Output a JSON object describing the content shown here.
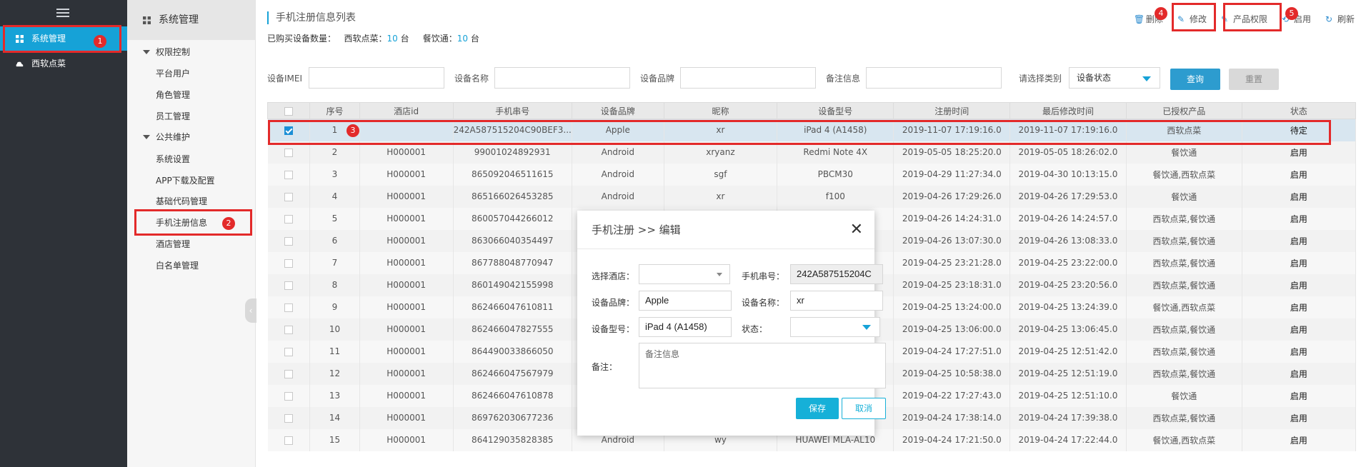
{
  "nav": {
    "items": [
      {
        "label": "系统管理",
        "icon": "grid-icon",
        "active": true
      },
      {
        "label": "西软点菜",
        "icon": "cloud-icon",
        "active": false
      }
    ]
  },
  "subnav": {
    "title": "系统管理",
    "groups": [
      {
        "label": "权限控制",
        "items": [
          "平台用户",
          "角色管理",
          "员工管理"
        ]
      },
      {
        "label": "公共维护",
        "items": [
          "系统设置",
          "APP下载及配置",
          "基础代码管理",
          "手机注册信息",
          "酒店管理",
          "白名单管理"
        ]
      }
    ]
  },
  "page": {
    "title": "手机注册信息列表",
    "summary_prefix": "已购买设备数量：",
    "summary_a_label": "西软点菜：",
    "summary_a_num": "10",
    "summary_a_unit": "台",
    "summary_b_label": "餐饮通：",
    "summary_b_num": "10",
    "summary_b_unit": "台"
  },
  "toolbar": {
    "delete": "删除",
    "edit": "修改",
    "product_perm": "产品权限",
    "enable": "启用",
    "refresh": "刷新"
  },
  "filter": {
    "imei_label": "设备IMEI",
    "name_label": "设备名称",
    "brand_label": "设备品牌",
    "remark_label": "备注信息",
    "type_label": "请选择类别",
    "type_value": "设备状态",
    "query": "查询",
    "reset": "重置"
  },
  "table": {
    "headers": [
      "序号",
      "酒店id",
      "手机串号",
      "设备品牌",
      "昵称",
      "设备型号",
      "注册时间",
      "最后修改时间",
      "已授权产品",
      "状态"
    ],
    "rows": [
      [
        "1",
        "",
        "242A587515204C90BEF3...",
        "Apple",
        "xr",
        "iPad 4 (A1458)",
        "2019-11-07 17:19:16.0",
        "2019-11-07 17:19:16.0",
        "西软点菜",
        "待定"
      ],
      [
        "2",
        "H000001",
        "99001024892931",
        "Android",
        "xryanz",
        "Redmi Note 4X",
        "2019-05-05 18:25:20.0",
        "2019-05-05 18:26:02.0",
        "餐饮通",
        "启用"
      ],
      [
        "3",
        "H000001",
        "865092046511615",
        "Android",
        "sgf",
        "PBCM30",
        "2019-04-29 11:27:34.0",
        "2019-04-30 10:13:15.0",
        "餐饮通,西软点菜",
        "启用"
      ],
      [
        "4",
        "H000001",
        "865166026453285",
        "Android",
        "xr",
        "f100",
        "2019-04-26 17:29:26.0",
        "2019-04-26 17:29:53.0",
        "餐饮通",
        "启用"
      ],
      [
        "5",
        "H000001",
        "860057044266012",
        "",
        "",
        "",
        "2019-04-26 14:24:31.0",
        "2019-04-26 14:24:57.0",
        "西软点菜,餐饮通",
        "启用"
      ],
      [
        "6",
        "H000001",
        "863066040354497",
        "",
        "",
        "",
        "2019-04-26 13:07:30.0",
        "2019-04-26 13:08:33.0",
        "西软点菜,餐饮通",
        "启用"
      ],
      [
        "7",
        "H000001",
        "867788048770947",
        "",
        "",
        "",
        "2019-04-25 23:21:28.0",
        "2019-04-25 23:22:00.0",
        "西软点菜,餐饮通",
        "启用"
      ],
      [
        "8",
        "H000001",
        "860149042155998",
        "",
        "",
        "",
        "2019-04-25 23:18:31.0",
        "2019-04-25 23:20:56.0",
        "西软点菜,餐饮通",
        "启用"
      ],
      [
        "9",
        "H000001",
        "862466047610811",
        "",
        "",
        "",
        "2019-04-25 13:24:00.0",
        "2019-04-25 13:24:39.0",
        "餐饮通,西软点菜",
        "启用"
      ],
      [
        "10",
        "H000001",
        "862466047827555",
        "",
        "",
        "",
        "2019-04-25 13:06:00.0",
        "2019-04-25 13:06:45.0",
        "西软点菜,餐饮通",
        "启用"
      ],
      [
        "11",
        "H000001",
        "864490033866050",
        "",
        "",
        "",
        "2019-04-24 17:27:51.0",
        "2019-04-25 12:51:42.0",
        "西软点菜,餐饮通",
        "启用"
      ],
      [
        "12",
        "H000001",
        "862466047567979",
        "",
        "",
        "",
        "2019-04-25 10:58:38.0",
        "2019-04-25 12:51:19.0",
        "西软点菜,餐饮通",
        "启用"
      ],
      [
        "13",
        "H000001",
        "862466047610878",
        "",
        "",
        "",
        "2019-04-22 17:27:43.0",
        "2019-04-25 12:51:10.0",
        "餐饮通",
        "启用"
      ],
      [
        "14",
        "H000001",
        "869762030677236",
        "",
        "",
        "",
        "2019-04-24 17:38:14.0",
        "2019-04-24 17:39:38.0",
        "西软点菜,餐饮通",
        "启用"
      ],
      [
        "15",
        "H000001",
        "864129035828385",
        "Android",
        "wy",
        "HUAWEI MLA-AL10",
        "2019-04-24 17:21:50.0",
        "2019-04-24 17:22:44.0",
        "餐饮通,西软点菜",
        "启用"
      ]
    ]
  },
  "modal": {
    "title": "手机注册 >> 编辑",
    "hotel_label": "选择酒店：",
    "imei_label": "手机串号：",
    "imei_value": "242A587515204C",
    "brand_label": "设备品牌：",
    "brand_value": "Apple",
    "name_label": "设备名称：",
    "name_value": "xr",
    "model_label": "设备型号：",
    "model_value": "iPad 4 (A1458)",
    "status_label": "状态：",
    "remark_label": "备注：",
    "remark_placeholder": "备注信息",
    "save": "保存",
    "cancel": "取消"
  },
  "annotations": [
    "1",
    "2",
    "3",
    "4",
    "5"
  ],
  "colors": {
    "accent": "#16a2d7",
    "annotation": "#e32a2a",
    "sidebar": "#2e3238"
  }
}
